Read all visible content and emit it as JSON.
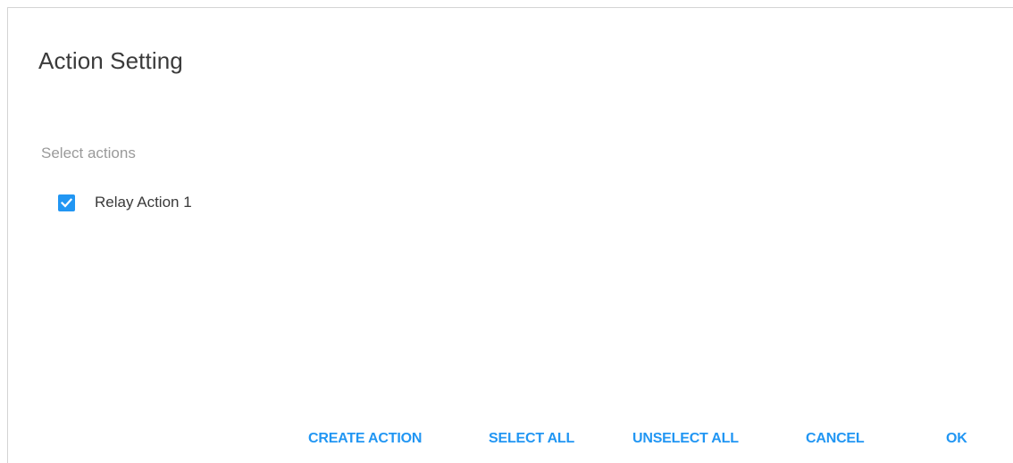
{
  "dialog": {
    "title": "Action Setting",
    "section_label": "Select actions",
    "options": [
      {
        "label": "Relay Action 1",
        "checked": true
      }
    ],
    "buttons": {
      "create_action": "CREATE ACTION",
      "select_all": "SELECT ALL",
      "unselect_all": "UNSELECT ALL",
      "cancel": "CANCEL",
      "ok": "OK"
    }
  },
  "colors": {
    "accent": "#2196f3",
    "title_text": "#3a3a3a",
    "muted_text": "#9a9a9a"
  },
  "icons": {
    "checkbox": "check-icon"
  }
}
